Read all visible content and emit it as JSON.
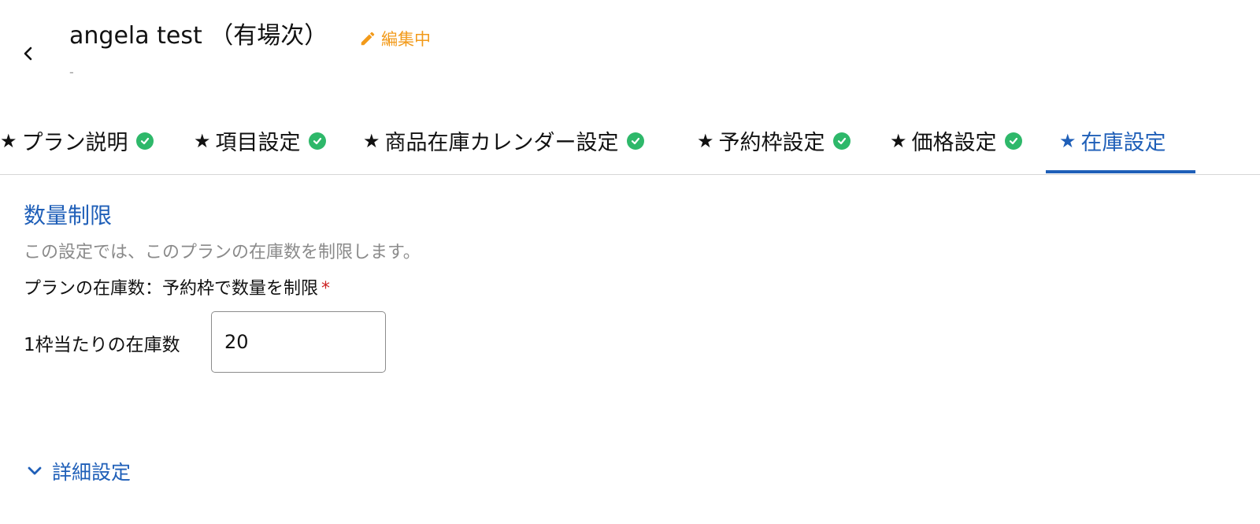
{
  "header": {
    "title": "angela test （有場次）",
    "edit_status": "編集中",
    "subtitle": "-"
  },
  "tabs": [
    {
      "label": "プラン説明",
      "completed": true,
      "active": false
    },
    {
      "label": "項目設定",
      "completed": true,
      "active": false
    },
    {
      "label": "商品在庫カレンダー設定",
      "completed": true,
      "active": false
    },
    {
      "label": "予約枠設定",
      "completed": true,
      "active": false
    },
    {
      "label": "価格設定",
      "completed": true,
      "active": false
    },
    {
      "label": "在庫設定",
      "completed": false,
      "active": true
    }
  ],
  "tab_star": "★",
  "section": {
    "title": "数量制限",
    "description": "この設定では、このプランの在庫数を制限します。",
    "field_label": "プランの在庫数：予約枠で数量を制限",
    "required_mark": "*",
    "stock_label": "1枠当たりの在庫数",
    "stock_value": "20"
  },
  "details_toggle": "詳細設定",
  "colors": {
    "accent": "#1f5fb8",
    "edit_status": "#f29a1a",
    "check": "#2eb86a",
    "required": "#cc2222"
  },
  "icons": {
    "back": "chevron-left-icon",
    "edit": "pencil-icon",
    "check": "check-circle-icon",
    "expand": "chevron-down-icon"
  }
}
